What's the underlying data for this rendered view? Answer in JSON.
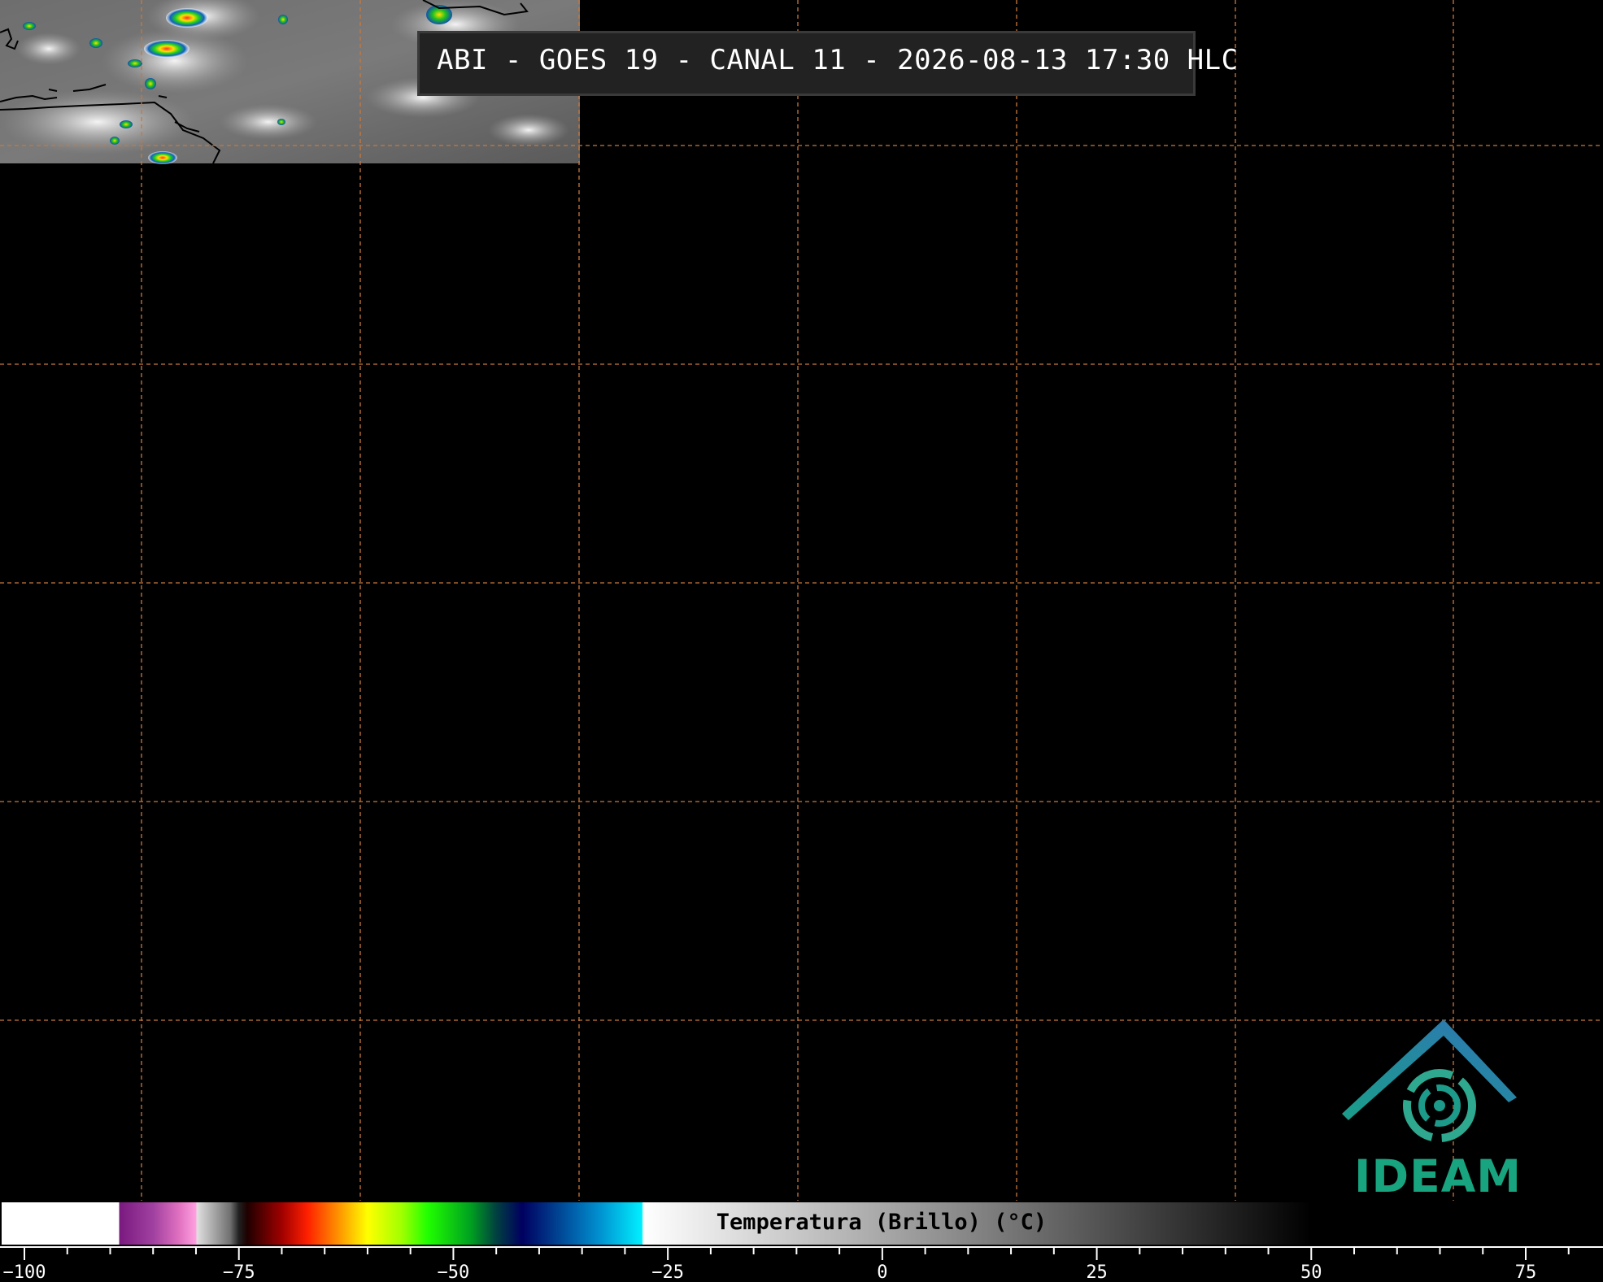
{
  "title": "ABI - GOES 19 - CANAL 11 - 2026-08-13 17:30 HLC",
  "colorbar": {
    "label": "Temperatura (Brillo) (°C)",
    "ticks": [
      -100,
      -75,
      -50,
      -25,
      0,
      25,
      50,
      75
    ],
    "tick_labels": [
      "−100",
      "−75",
      "−50",
      "−25",
      "0",
      "25",
      "50",
      "75"
    ]
  },
  "logo": {
    "text": "IDEAM"
  },
  "colors": {
    "grid": "#c8783c",
    "background": "#000000",
    "logo_teal": "#17a47e",
    "logo_blue": "#2f74b5"
  }
}
